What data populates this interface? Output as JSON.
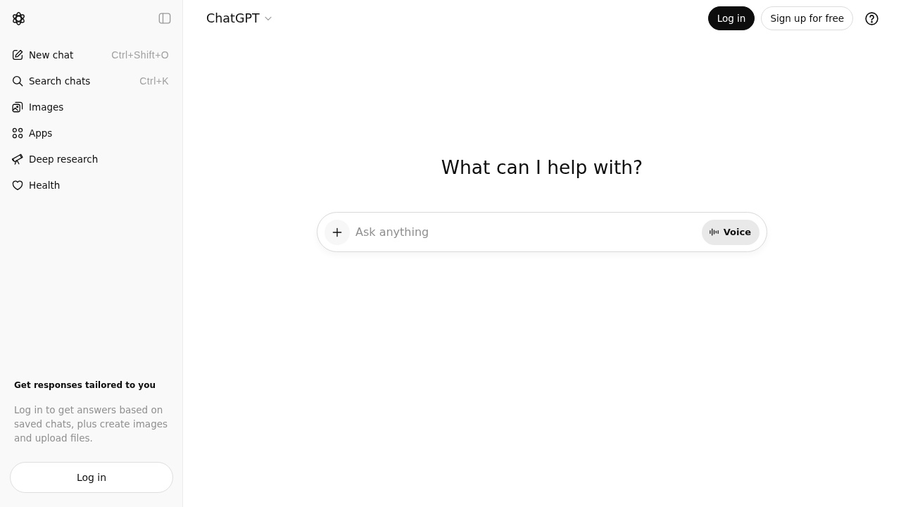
{
  "sidebar": {
    "items": [
      {
        "label": "New chat",
        "shortcut": "Ctrl+Shift+O"
      },
      {
        "label": "Search chats",
        "shortcut": "Ctrl+K"
      },
      {
        "label": "Images"
      },
      {
        "label": "Apps"
      },
      {
        "label": "Deep research"
      },
      {
        "label": "Health"
      }
    ],
    "promo": {
      "title": "Get responses tailored to you",
      "text": "Log in to get answers based on saved chats, plus create images and upload files.",
      "button": "Log in"
    }
  },
  "header": {
    "model": "ChatGPT",
    "buttons": [
      {
        "label": "Log in",
        "kind": "primary"
      },
      {
        "label": "Sign up for free",
        "kind": "secondary"
      }
    ]
  },
  "main": {
    "heading": "What can I help with?",
    "composer": {
      "placeholder": "Ask anything",
      "voice_button": "Voice"
    }
  }
}
